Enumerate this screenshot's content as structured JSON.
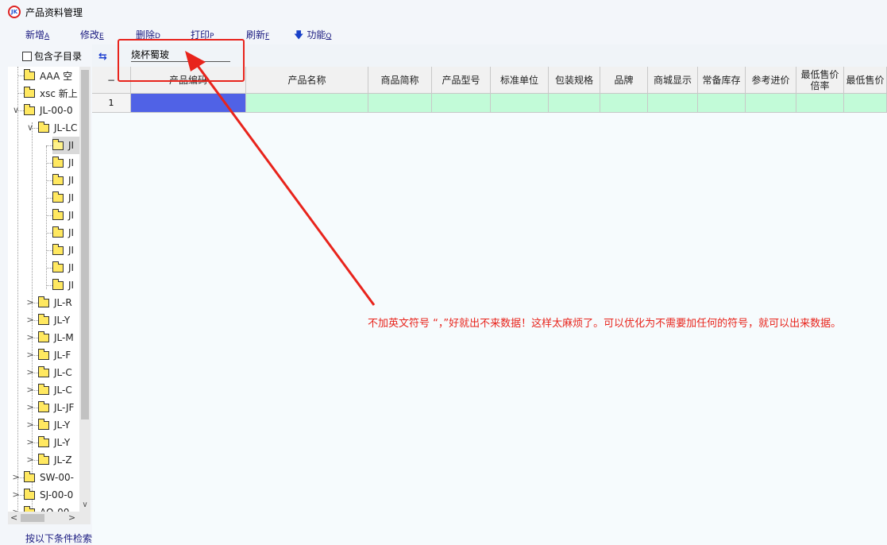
{
  "window": {
    "title": "产品资料管理",
    "icon": "app-logo-icon",
    "icon_text": "JK"
  },
  "toolbar": {
    "add": {
      "label": "新增",
      "hotkey": "A"
    },
    "edit": {
      "label": "修改",
      "hotkey": "E"
    },
    "delete": {
      "label": "删除",
      "hotkey": "D"
    },
    "print": {
      "label": "打印",
      "hotkey": "P"
    },
    "refresh": {
      "label": "刷新",
      "hotkey": "F"
    },
    "functions": {
      "label": "功能",
      "hotkey": "Q",
      "icon": "down-arrow-icon"
    }
  },
  "left_panel": {
    "include_subdirs_label": "包含子目录",
    "include_subdirs_checked": false,
    "tree": [
      {
        "label": "AAA 空",
        "level": 0,
        "expander": ""
      },
      {
        "label": "xsc 新上",
        "level": 0,
        "expander": ""
      },
      {
        "label": "JL-00-0",
        "level": 0,
        "expander": "v"
      },
      {
        "label": "JL-LC",
        "level": 1,
        "expander": "v"
      },
      {
        "label": "JI",
        "level": 2,
        "expander": "",
        "selected": true,
        "open": true
      },
      {
        "label": "JI",
        "level": 2,
        "expander": ""
      },
      {
        "label": "JI",
        "level": 2,
        "expander": ""
      },
      {
        "label": "JI",
        "level": 2,
        "expander": ""
      },
      {
        "label": "JI",
        "level": 2,
        "expander": ""
      },
      {
        "label": "JI",
        "level": 2,
        "expander": ""
      },
      {
        "label": "JI",
        "level": 2,
        "expander": ""
      },
      {
        "label": "JI",
        "level": 2,
        "expander": ""
      },
      {
        "label": "JI",
        "level": 2,
        "expander": ""
      },
      {
        "label": "JL-R",
        "level": 1,
        "expander": ">"
      },
      {
        "label": "JL-Y",
        "level": 1,
        "expander": ">"
      },
      {
        "label": "JL-M",
        "level": 1,
        "expander": ">"
      },
      {
        "label": "JL-F",
        "level": 1,
        "expander": ">"
      },
      {
        "label": "JL-C",
        "level": 1,
        "expander": ">"
      },
      {
        "label": "JL-C",
        "level": 1,
        "expander": ">"
      },
      {
        "label": "JL-JF",
        "level": 1,
        "expander": ">"
      },
      {
        "label": "JL-Y",
        "level": 1,
        "expander": ">"
      },
      {
        "label": "JL-Y",
        "level": 1,
        "expander": ">"
      },
      {
        "label": "JL-Z",
        "level": 1,
        "expander": ">"
      },
      {
        "label": "SW-00-",
        "level": 0,
        "expander": ">"
      },
      {
        "label": "SJ-00-0",
        "level": 0,
        "expander": ">"
      },
      {
        "label": "AQ-00-",
        "level": 0,
        "expander": ">"
      }
    ],
    "bottom_link": "按以下条件检索"
  },
  "search": {
    "value": "烧杯蜀玻",
    "icon": "swap-arrows-icon"
  },
  "grid": {
    "corner": "−",
    "columns": [
      "产品编码",
      "产品名称",
      "商品简称",
      "产品型号",
      "标准单位",
      "包装规格",
      "品牌",
      "商城显示",
      "常备库存",
      "参考进价",
      "最低售价倍率",
      "最低售价"
    ],
    "rows": [
      {
        "num": "1",
        "cells": [
          "",
          "",
          "",
          "",
          "",
          "",
          "",
          "",
          "",
          "",
          "",
          ""
        ]
      }
    ]
  },
  "annotation": {
    "text": "不加英文符号 “，”好就出不来数据！这样太麻烦了。可以优化为不需要加任何的符号，就可以出来数据。",
    "color": "#e8241c"
  }
}
